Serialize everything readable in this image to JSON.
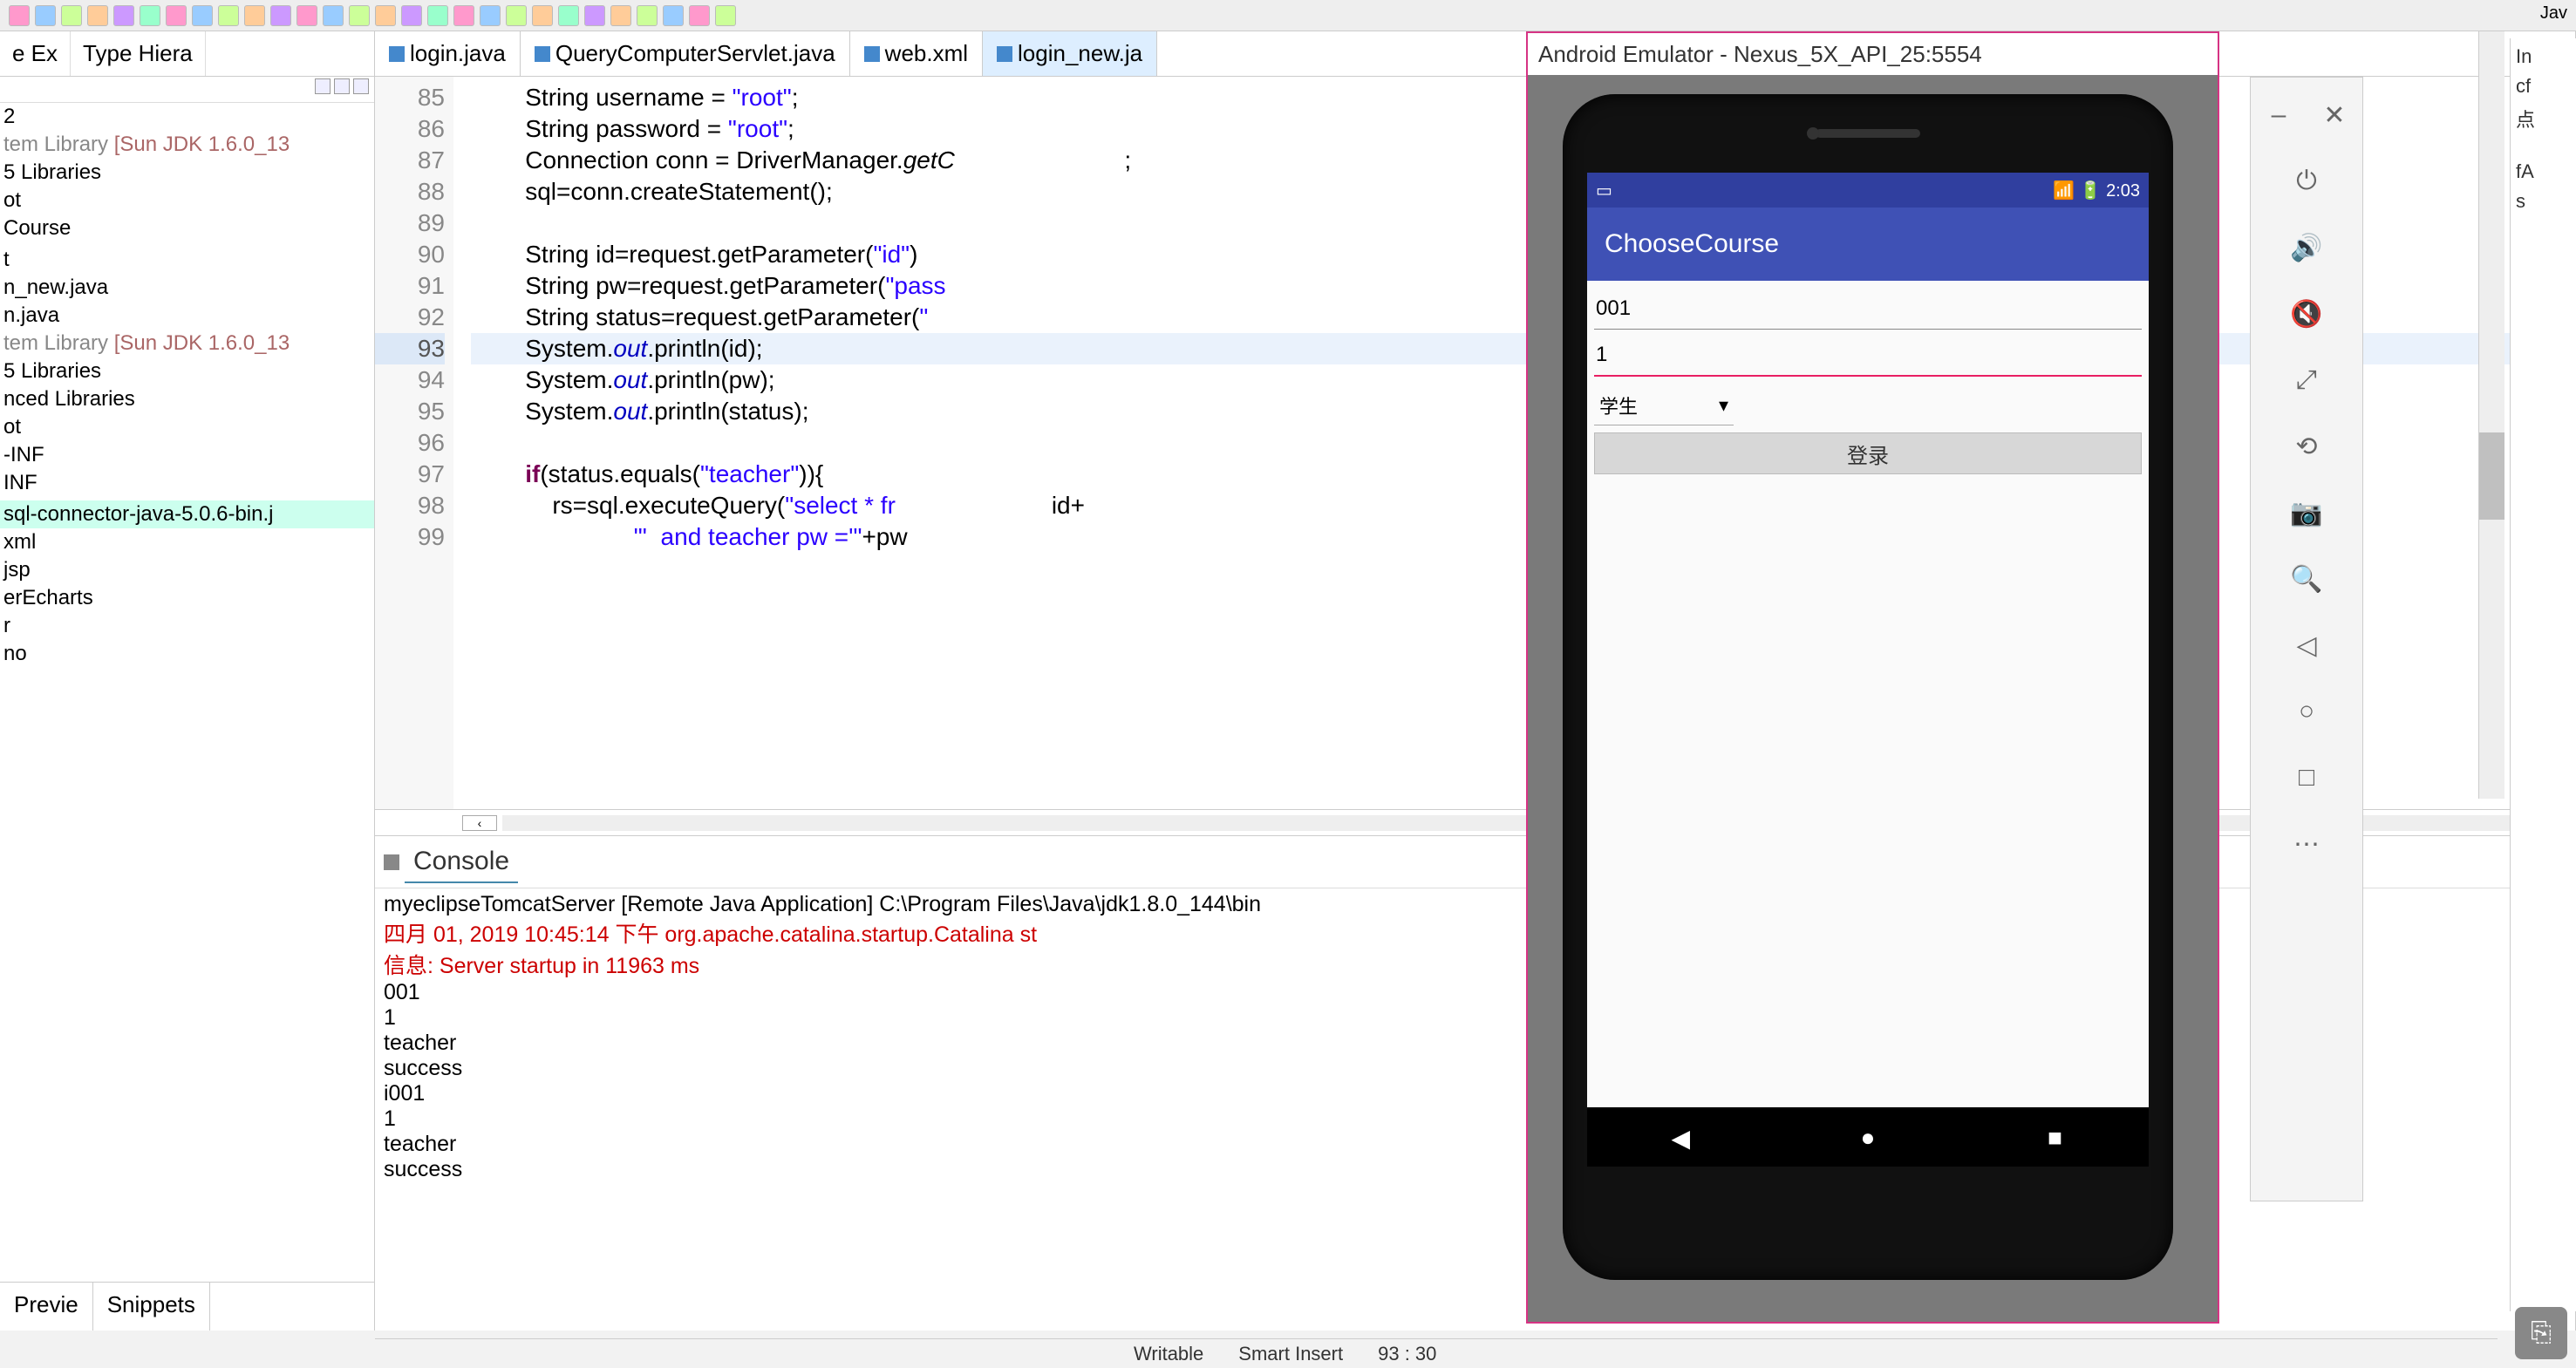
{
  "perspective_label": "Jav",
  "left_panel": {
    "tabs": [
      "e Ex",
      "Type Hiera"
    ],
    "tree": [
      {
        "text": "2",
        "sys": false
      },
      {
        "text": "tem Library",
        "ver": "[Sun JDK 1.6.0_13"
      },
      {
        "text": " 5 Libraries",
        "sys": false
      },
      {
        "text": "ot",
        "sys": false
      },
      {
        "text": "Course",
        "sys": false
      },
      {
        "text": "",
        "sys": false
      },
      {
        "text": "t",
        "sys": false
      },
      {
        "text": "n_new.java",
        "sys": false
      },
      {
        "text": "n.java",
        "sys": false
      },
      {
        "text": "tem Library",
        "ver": "[Sun JDK 1.6.0_13"
      },
      {
        "text": " 5 Libraries",
        "sys": false
      },
      {
        "text": "nced Libraries",
        "sys": false
      },
      {
        "text": "ot",
        "sys": false
      },
      {
        "text": "-INF",
        "sys": false
      },
      {
        "text": "INF",
        "sys": false
      },
      {
        "text": "",
        "sys": false
      },
      {
        "text": "sql-connector-java-5.0.6-bin.j",
        "sel": true
      },
      {
        "text": "xml",
        "sys": false
      },
      {
        "text": "jsp",
        "sys": false
      },
      {
        "text": "erEcharts",
        "sys": false
      },
      {
        "text": "r",
        "sys": false
      },
      {
        "text": "no",
        "sys": false
      }
    ],
    "bottom_tabs": [
      "Previe",
      "Snippets"
    ]
  },
  "editor": {
    "tabs": [
      {
        "label": "login.java",
        "active": false
      },
      {
        "label": "QueryComputerServlet.java",
        "active": false
      },
      {
        "label": "web.xml",
        "active": false
      },
      {
        "label": "login_new.ja",
        "active": true
      }
    ],
    "first_line_no": 85,
    "current_line_no": 93,
    "lines": [
      {
        "n": 85,
        "html": "        String username = <span class='str'>\"root\"</span>;"
      },
      {
        "n": 86,
        "html": "        String password = <span class='str'>\"root\"</span>;"
      },
      {
        "n": 87,
        "html": "        Connection conn = DriverManager.<span class='mth'>getC</span>                         ;"
      },
      {
        "n": 88,
        "html": "        sql=conn.createStatement();"
      },
      {
        "n": 89,
        "html": ""
      },
      {
        "n": 90,
        "html": "        String id=request.getParameter(<span class='str'>\"id\"</span>)"
      },
      {
        "n": 91,
        "html": "        String pw=request.getParameter(<span class='str'>\"pass</span>"
      },
      {
        "n": 92,
        "html": "        String status=request.getParameter(<span class='str'>\"</span>"
      },
      {
        "n": 93,
        "html": "        System.<span class='fld'>out</span>.println(id);"
      },
      {
        "n": 94,
        "html": "        System.<span class='fld'>out</span>.println(pw);"
      },
      {
        "n": 95,
        "html": "        System.<span class='fld'>out</span>.println(status);"
      },
      {
        "n": 96,
        "html": ""
      },
      {
        "n": 97,
        "html": "        <span class='kw'>if</span>(status.equals(<span class='str'>\"teacher\"</span>)){"
      },
      {
        "n": 98,
        "html": "            rs=sql.executeQuery(<span class='str'>\"select * fr</span>                       id+"
      },
      {
        "n": 99,
        "html": "                        <span class='str'>\"'  and teacher pw ='\"</span>+pw"
      }
    ]
  },
  "console": {
    "tab_label": "Console",
    "launch": "myeclipseTomcatServer [Remote Java Application] C:\\Program Files\\Java\\jdk1.8.0_144\\bin",
    "lines": [
      {
        "t": "st",
        "s": "四月 01, 2019 10:45:14 下午 org.apache.catalina.startup.Catalina st"
      },
      {
        "t": "st",
        "s": "信息: Server startup in 11963 ms"
      },
      {
        "t": "out",
        "s": "001"
      },
      {
        "t": "out",
        "s": "1"
      },
      {
        "t": "out",
        "s": "teacher"
      },
      {
        "t": "out",
        "s": "success"
      },
      {
        "t": "out",
        "s": "i001"
      },
      {
        "t": "out",
        "s": "1"
      },
      {
        "t": "out",
        "s": "teacher"
      },
      {
        "t": "out",
        "s": "success"
      }
    ]
  },
  "status": {
    "writable": "Writable",
    "insert": "Smart Insert",
    "pos": "93 : 30"
  },
  "emulator": {
    "title": "Android Emulator - Nexus_5X_API_25:5554",
    "status_time": "2:03",
    "app_title": "ChooseCourse",
    "field_user": "001",
    "field_pass": "1",
    "spinner": "学生",
    "login_btn": "登录",
    "controls_top": [
      "–",
      "✕"
    ],
    "controls": [
      "⏻",
      "🔊",
      "🔇",
      "⤢",
      "⟲",
      "📷",
      "🔍",
      "◁",
      "○",
      "□",
      "⋯"
    ]
  },
  "right_remnant": [
    "In",
    "cf",
    "点",
    "",
    "",
    "",
    "fA",
    "s"
  ]
}
